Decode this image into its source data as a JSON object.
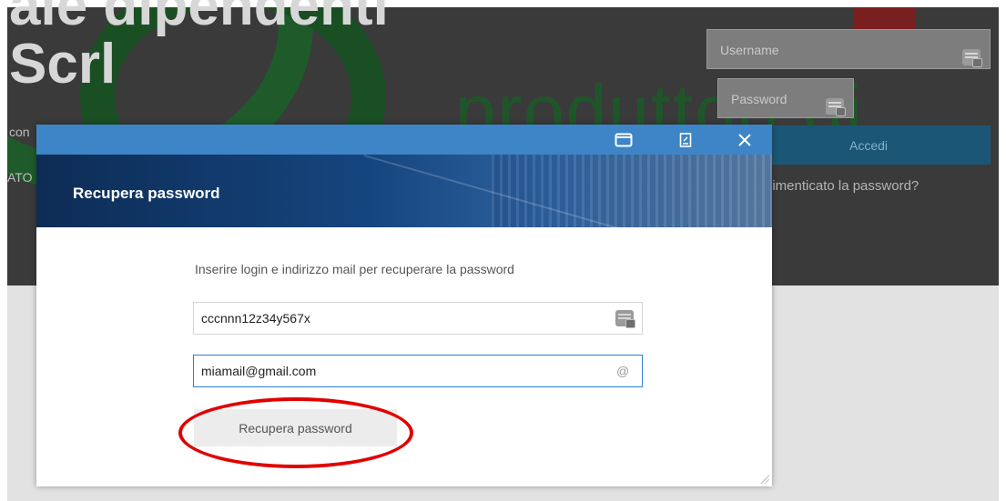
{
  "background": {
    "title_line1": "ale dipendenti",
    "title_line2": "Scrl",
    "watermark": "produttori di",
    "left_text1": "con",
    "left_text2": "ATO I",
    "username_placeholder": "Username",
    "password_placeholder": "Password",
    "login_button": "Accedi",
    "forgot_link": "dimenticato la password?"
  },
  "modal": {
    "title": "Recupera password",
    "instructions": "Inserire login e indirizzo mail per recuperare la password",
    "login_value": "cccnnn12z34y567x",
    "email_value": "miamail@gmail.com",
    "email_icon": "@",
    "submit_label": "Recupera password",
    "header_icons": [
      "maximize-icon",
      "pdf-icon",
      "close-icon"
    ]
  },
  "colors": {
    "accent": "#3d85c6",
    "focus_border": "#2a7fd4",
    "annotation": "#e10000"
  }
}
